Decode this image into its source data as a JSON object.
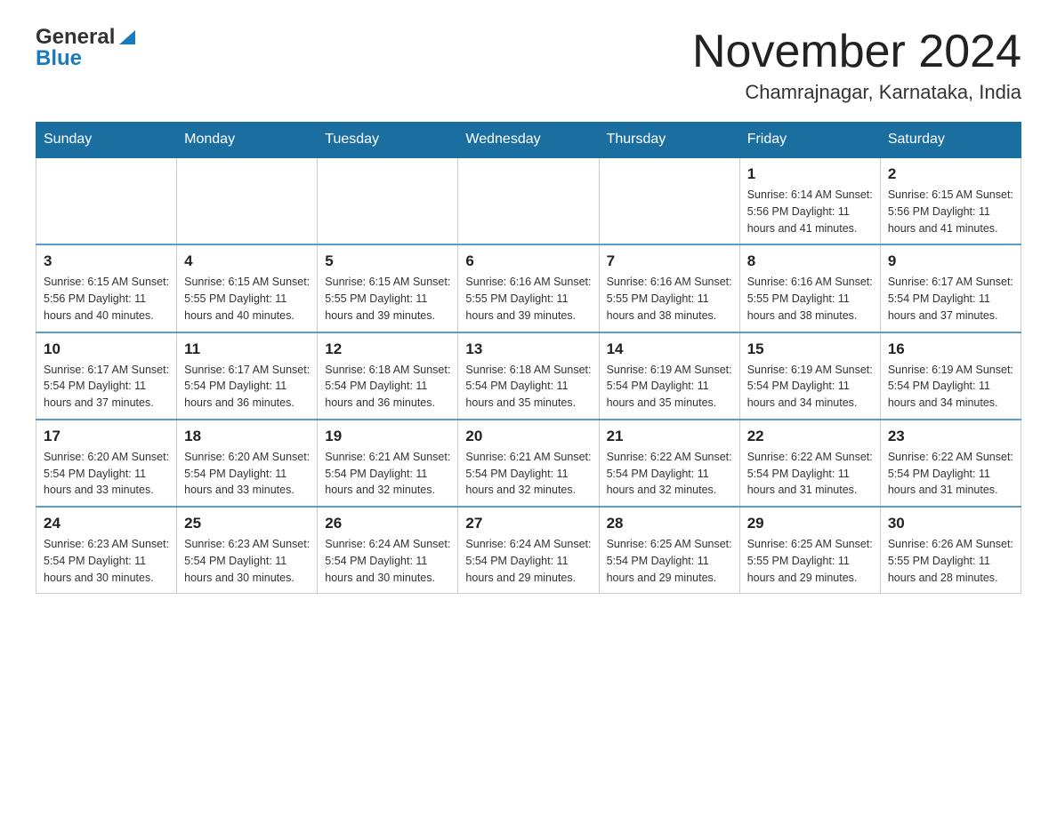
{
  "header": {
    "logo_general": "General",
    "logo_blue": "Blue",
    "month_title": "November 2024",
    "location": "Chamrajnagar, Karnataka, India"
  },
  "days_of_week": [
    "Sunday",
    "Monday",
    "Tuesday",
    "Wednesday",
    "Thursday",
    "Friday",
    "Saturday"
  ],
  "weeks": [
    [
      {
        "day": "",
        "info": ""
      },
      {
        "day": "",
        "info": ""
      },
      {
        "day": "",
        "info": ""
      },
      {
        "day": "",
        "info": ""
      },
      {
        "day": "",
        "info": ""
      },
      {
        "day": "1",
        "info": "Sunrise: 6:14 AM\nSunset: 5:56 PM\nDaylight: 11 hours and 41 minutes."
      },
      {
        "day": "2",
        "info": "Sunrise: 6:15 AM\nSunset: 5:56 PM\nDaylight: 11 hours and 41 minutes."
      }
    ],
    [
      {
        "day": "3",
        "info": "Sunrise: 6:15 AM\nSunset: 5:56 PM\nDaylight: 11 hours and 40 minutes."
      },
      {
        "day": "4",
        "info": "Sunrise: 6:15 AM\nSunset: 5:55 PM\nDaylight: 11 hours and 40 minutes."
      },
      {
        "day": "5",
        "info": "Sunrise: 6:15 AM\nSunset: 5:55 PM\nDaylight: 11 hours and 39 minutes."
      },
      {
        "day": "6",
        "info": "Sunrise: 6:16 AM\nSunset: 5:55 PM\nDaylight: 11 hours and 39 minutes."
      },
      {
        "day": "7",
        "info": "Sunrise: 6:16 AM\nSunset: 5:55 PM\nDaylight: 11 hours and 38 minutes."
      },
      {
        "day": "8",
        "info": "Sunrise: 6:16 AM\nSunset: 5:55 PM\nDaylight: 11 hours and 38 minutes."
      },
      {
        "day": "9",
        "info": "Sunrise: 6:17 AM\nSunset: 5:54 PM\nDaylight: 11 hours and 37 minutes."
      }
    ],
    [
      {
        "day": "10",
        "info": "Sunrise: 6:17 AM\nSunset: 5:54 PM\nDaylight: 11 hours and 37 minutes."
      },
      {
        "day": "11",
        "info": "Sunrise: 6:17 AM\nSunset: 5:54 PM\nDaylight: 11 hours and 36 minutes."
      },
      {
        "day": "12",
        "info": "Sunrise: 6:18 AM\nSunset: 5:54 PM\nDaylight: 11 hours and 36 minutes."
      },
      {
        "day": "13",
        "info": "Sunrise: 6:18 AM\nSunset: 5:54 PM\nDaylight: 11 hours and 35 minutes."
      },
      {
        "day": "14",
        "info": "Sunrise: 6:19 AM\nSunset: 5:54 PM\nDaylight: 11 hours and 35 minutes."
      },
      {
        "day": "15",
        "info": "Sunrise: 6:19 AM\nSunset: 5:54 PM\nDaylight: 11 hours and 34 minutes."
      },
      {
        "day": "16",
        "info": "Sunrise: 6:19 AM\nSunset: 5:54 PM\nDaylight: 11 hours and 34 minutes."
      }
    ],
    [
      {
        "day": "17",
        "info": "Sunrise: 6:20 AM\nSunset: 5:54 PM\nDaylight: 11 hours and 33 minutes."
      },
      {
        "day": "18",
        "info": "Sunrise: 6:20 AM\nSunset: 5:54 PM\nDaylight: 11 hours and 33 minutes."
      },
      {
        "day": "19",
        "info": "Sunrise: 6:21 AM\nSunset: 5:54 PM\nDaylight: 11 hours and 32 minutes."
      },
      {
        "day": "20",
        "info": "Sunrise: 6:21 AM\nSunset: 5:54 PM\nDaylight: 11 hours and 32 minutes."
      },
      {
        "day": "21",
        "info": "Sunrise: 6:22 AM\nSunset: 5:54 PM\nDaylight: 11 hours and 32 minutes."
      },
      {
        "day": "22",
        "info": "Sunrise: 6:22 AM\nSunset: 5:54 PM\nDaylight: 11 hours and 31 minutes."
      },
      {
        "day": "23",
        "info": "Sunrise: 6:22 AM\nSunset: 5:54 PM\nDaylight: 11 hours and 31 minutes."
      }
    ],
    [
      {
        "day": "24",
        "info": "Sunrise: 6:23 AM\nSunset: 5:54 PM\nDaylight: 11 hours and 30 minutes."
      },
      {
        "day": "25",
        "info": "Sunrise: 6:23 AM\nSunset: 5:54 PM\nDaylight: 11 hours and 30 minutes."
      },
      {
        "day": "26",
        "info": "Sunrise: 6:24 AM\nSunset: 5:54 PM\nDaylight: 11 hours and 30 minutes."
      },
      {
        "day": "27",
        "info": "Sunrise: 6:24 AM\nSunset: 5:54 PM\nDaylight: 11 hours and 29 minutes."
      },
      {
        "day": "28",
        "info": "Sunrise: 6:25 AM\nSunset: 5:54 PM\nDaylight: 11 hours and 29 minutes."
      },
      {
        "day": "29",
        "info": "Sunrise: 6:25 AM\nSunset: 5:55 PM\nDaylight: 11 hours and 29 minutes."
      },
      {
        "day": "30",
        "info": "Sunrise: 6:26 AM\nSunset: 5:55 PM\nDaylight: 11 hours and 28 minutes."
      }
    ]
  ]
}
